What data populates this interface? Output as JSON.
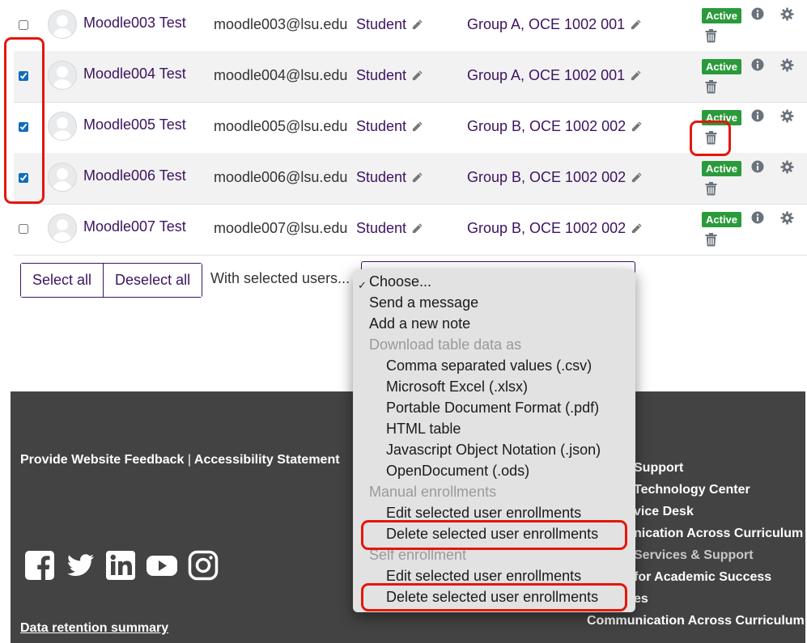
{
  "participants": [
    {
      "name": "Moodle003 Test",
      "email": "moodle003@lsu.edu",
      "role": "Student",
      "group": "Group A, OCE 1002 001",
      "status": "Active",
      "checked": false
    },
    {
      "name": "Moodle004 Test",
      "email": "moodle004@lsu.edu",
      "role": "Student",
      "group": "Group A, OCE 1002 001",
      "status": "Active",
      "checked": true
    },
    {
      "name": "Moodle005 Test",
      "email": "moodle005@lsu.edu",
      "role": "Student",
      "group": "Group B, OCE 1002 002",
      "status": "Active",
      "checked": true
    },
    {
      "name": "Moodle006 Test",
      "email": "moodle006@lsu.edu",
      "role": "Student",
      "group": "Group B, OCE 1002 002",
      "status": "Active",
      "checked": true
    },
    {
      "name": "Moodle007 Test",
      "email": "moodle007@lsu.edu",
      "role": "Student",
      "group": "Group B, OCE 1002 002",
      "status": "Active",
      "checked": false
    }
  ],
  "actions": {
    "select_all": "Select all",
    "deselect_all": "Deselect all",
    "with_selected_label": "With selected users..."
  },
  "dropdown": {
    "selected": "Choose...",
    "checkmark": "✓",
    "options": [
      {
        "label": "Choose...",
        "kind": "option"
      },
      {
        "label": "Send a message",
        "kind": "option"
      },
      {
        "label": "Add a new note",
        "kind": "option"
      },
      {
        "label": "Download table data as",
        "kind": "group"
      },
      {
        "label": "Comma separated values (.csv)",
        "kind": "sub"
      },
      {
        "label": "Microsoft Excel (.xlsx)",
        "kind": "sub"
      },
      {
        "label": "Portable Document Format (.pdf)",
        "kind": "sub"
      },
      {
        "label": "HTML table",
        "kind": "sub"
      },
      {
        "label": "Javascript Object Notation (.json)",
        "kind": "sub"
      },
      {
        "label": "OpenDocument (.ods)",
        "kind": "sub"
      },
      {
        "label": "Manual enrollments",
        "kind": "group"
      },
      {
        "label": "Edit selected user enrollments",
        "kind": "sub"
      },
      {
        "label": "Delete selected user enrollments",
        "kind": "sub"
      },
      {
        "label": "Self enrollment",
        "kind": "group"
      },
      {
        "label": "Edit selected user enrollments",
        "kind": "sub"
      },
      {
        "label": "Delete selected user enrollments",
        "kind": "sub"
      }
    ]
  },
  "footer": {
    "feedback": "Provide Website Feedback",
    "separator": "|",
    "accessibility": "Accessibility Statement",
    "retention": "Data retention summary",
    "social_icons": [
      "facebook-icon",
      "twitter-icon",
      "linkedin-icon",
      "youtube-icon",
      "instagram-icon"
    ],
    "right_links": [
      "Support",
      "Technology Center",
      "vice Desk",
      "nication Across Curriculum",
      "Services & Support",
      "for Academic Success",
      "es",
      "Communication Across Curriculum"
    ]
  },
  "colors": {
    "link": "#3c1361",
    "badge": "#2b9a3b",
    "footer_bg": "#434343",
    "highlight": "#e3170a"
  }
}
